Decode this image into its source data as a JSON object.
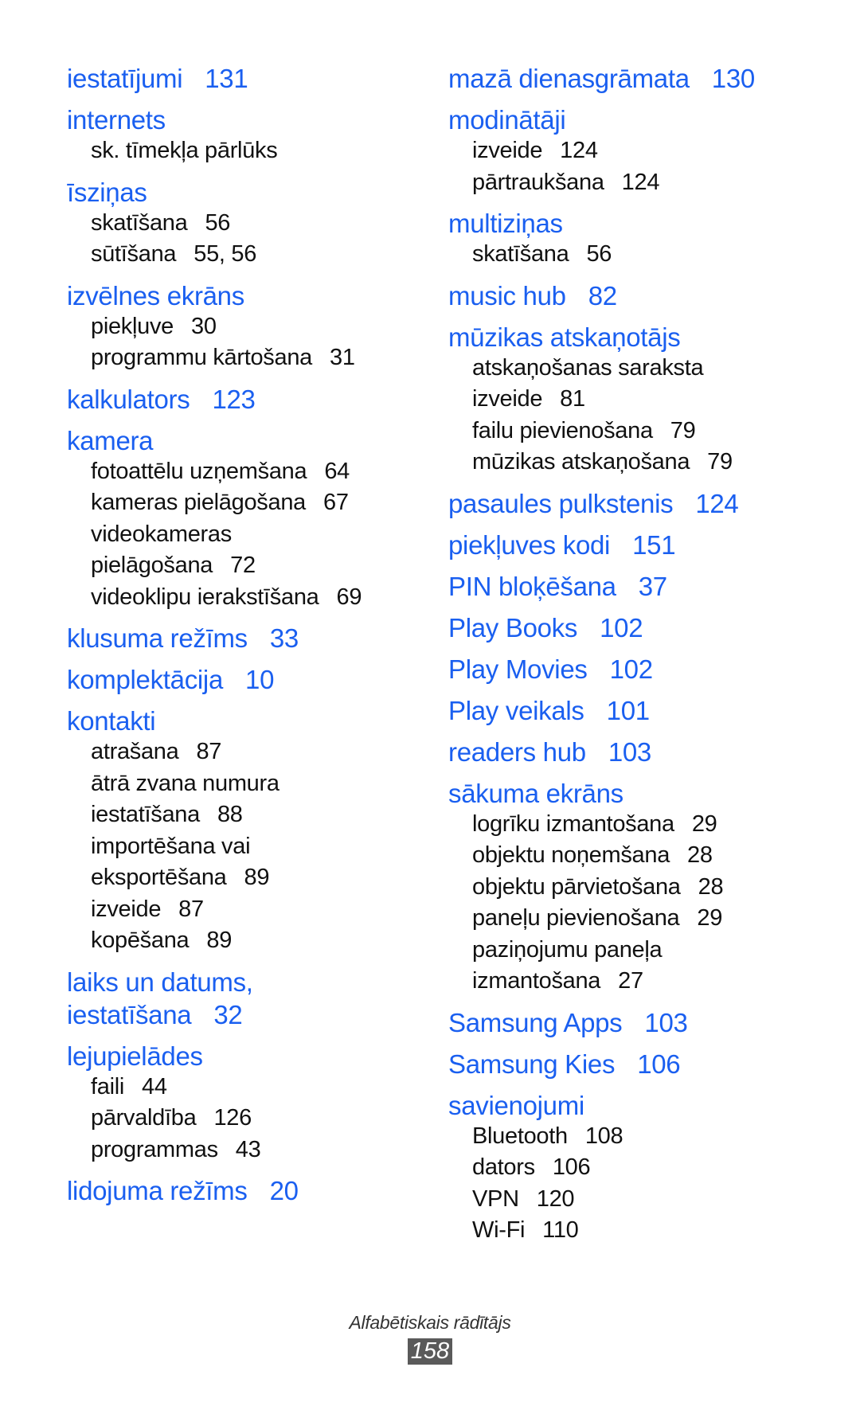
{
  "index": {
    "left_column": [
      {
        "term": "iestatījumi",
        "page": "131",
        "subs": []
      },
      {
        "term": "internets",
        "page": "",
        "subs": [
          {
            "lines": [
              "sk. tīmekļa pārlūks"
            ],
            "page": ""
          }
        ]
      },
      {
        "term": "īsziņas",
        "page": "",
        "subs": [
          {
            "lines": [
              "skatīšana"
            ],
            "page": "56"
          },
          {
            "lines": [
              "sūtīšana"
            ],
            "page": "55, 56"
          }
        ]
      },
      {
        "term": "izvēlnes ekrāns",
        "page": "",
        "subs": [
          {
            "lines": [
              "piekļuve"
            ],
            "page": "30"
          },
          {
            "lines": [
              "programmu kārtošana"
            ],
            "page": "31"
          }
        ]
      },
      {
        "term": "kalkulators",
        "page": "123",
        "subs": []
      },
      {
        "term": "kamera",
        "page": "",
        "subs": [
          {
            "lines": [
              "fotoattēlu uzņemšana"
            ],
            "page": "64"
          },
          {
            "lines": [
              "kameras pielāgošana"
            ],
            "page": "67"
          },
          {
            "lines": [
              "videokameras",
              "pielāgošana"
            ],
            "page": "72"
          },
          {
            "lines": [
              "videoklipu ierakstīšana"
            ],
            "page": "69"
          }
        ]
      },
      {
        "term": "klusuma režīms",
        "page": "33",
        "subs": []
      },
      {
        "term": "komplektācija",
        "page": "10",
        "subs": []
      },
      {
        "term": "kontakti",
        "page": "",
        "subs": [
          {
            "lines": [
              "atrašana"
            ],
            "page": "87"
          },
          {
            "lines": [
              "ātrā zvana numura",
              "iestatīšana"
            ],
            "page": "88"
          },
          {
            "lines": [
              "importēšana vai",
              "eksportēšana"
            ],
            "page": "89"
          },
          {
            "lines": [
              "izveide"
            ],
            "page": "87"
          },
          {
            "lines": [
              "kopēšana"
            ],
            "page": "89"
          }
        ]
      },
      {
        "term_lines": [
          "laiks un datums,",
          "iestatīšana"
        ],
        "page": "32",
        "subs": []
      },
      {
        "term": "lejupielādes",
        "page": "",
        "subs": [
          {
            "lines": [
              "faili"
            ],
            "page": "44"
          },
          {
            "lines": [
              "pārvaldība"
            ],
            "page": "126"
          },
          {
            "lines": [
              "programmas"
            ],
            "page": "43"
          }
        ]
      },
      {
        "term": "lidojuma režīms",
        "page": "20",
        "subs": []
      }
    ],
    "right_column": [
      {
        "term": "mazā dienasgrāmata",
        "page": "130",
        "subs": []
      },
      {
        "term": "modinātāji",
        "page": "",
        "subs": [
          {
            "lines": [
              "izveide"
            ],
            "page": "124"
          },
          {
            "lines": [
              "pārtraukšana"
            ],
            "page": "124"
          }
        ]
      },
      {
        "term": "multiziņas",
        "page": "",
        "subs": [
          {
            "lines": [
              "skatīšana"
            ],
            "page": "56"
          }
        ]
      },
      {
        "term": "music hub",
        "page": "82",
        "subs": []
      },
      {
        "term": "mūzikas atskaņotājs",
        "page": "",
        "subs": [
          {
            "lines": [
              "atskaņošanas saraksta",
              "izveide"
            ],
            "page": "81"
          },
          {
            "lines": [
              "failu pievienošana"
            ],
            "page": "79"
          },
          {
            "lines": [
              "mūzikas atskaņošana"
            ],
            "page": "79"
          }
        ]
      },
      {
        "term": "pasaules pulkstenis",
        "page": "124",
        "subs": []
      },
      {
        "term": "piekļuves kodi",
        "page": "151",
        "subs": []
      },
      {
        "term": "PIN bloķēšana",
        "page": "37",
        "subs": []
      },
      {
        "term": "Play Books",
        "page": "102",
        "subs": []
      },
      {
        "term": "Play Movies",
        "page": "102",
        "subs": []
      },
      {
        "term": "Play veikals",
        "page": "101",
        "subs": []
      },
      {
        "term": "readers hub",
        "page": "103",
        "subs": []
      },
      {
        "term": "sākuma ekrāns",
        "page": "",
        "subs": [
          {
            "lines": [
              "logrīku izmantošana"
            ],
            "page": "29"
          },
          {
            "lines": [
              "objektu noņemšana"
            ],
            "page": "28"
          },
          {
            "lines": [
              "objektu pārvietošana"
            ],
            "page": "28"
          },
          {
            "lines": [
              "paneļu pievienošana"
            ],
            "page": "29"
          },
          {
            "lines": [
              "paziņojumu paneļa",
              "izmantošana"
            ],
            "page": "27"
          }
        ]
      },
      {
        "term": "Samsung Apps",
        "page": "103",
        "subs": []
      },
      {
        "term": "Samsung Kies",
        "page": "106",
        "subs": []
      },
      {
        "term": "savienojumi",
        "page": "",
        "subs": [
          {
            "lines": [
              "Bluetooth"
            ],
            "page": "108"
          },
          {
            "lines": [
              "dators"
            ],
            "page": "106"
          },
          {
            "lines": [
              "VPN"
            ],
            "page": "120"
          },
          {
            "lines": [
              "Wi-Fi"
            ],
            "page": "110"
          }
        ]
      }
    ]
  },
  "footer": {
    "section_title": "Alfabētiskais rādītājs",
    "page_number": "158"
  },
  "colors": {
    "heading": "#1a5ff0",
    "subentry": "#111111",
    "page_badge_bg": "#5a5a5a"
  }
}
